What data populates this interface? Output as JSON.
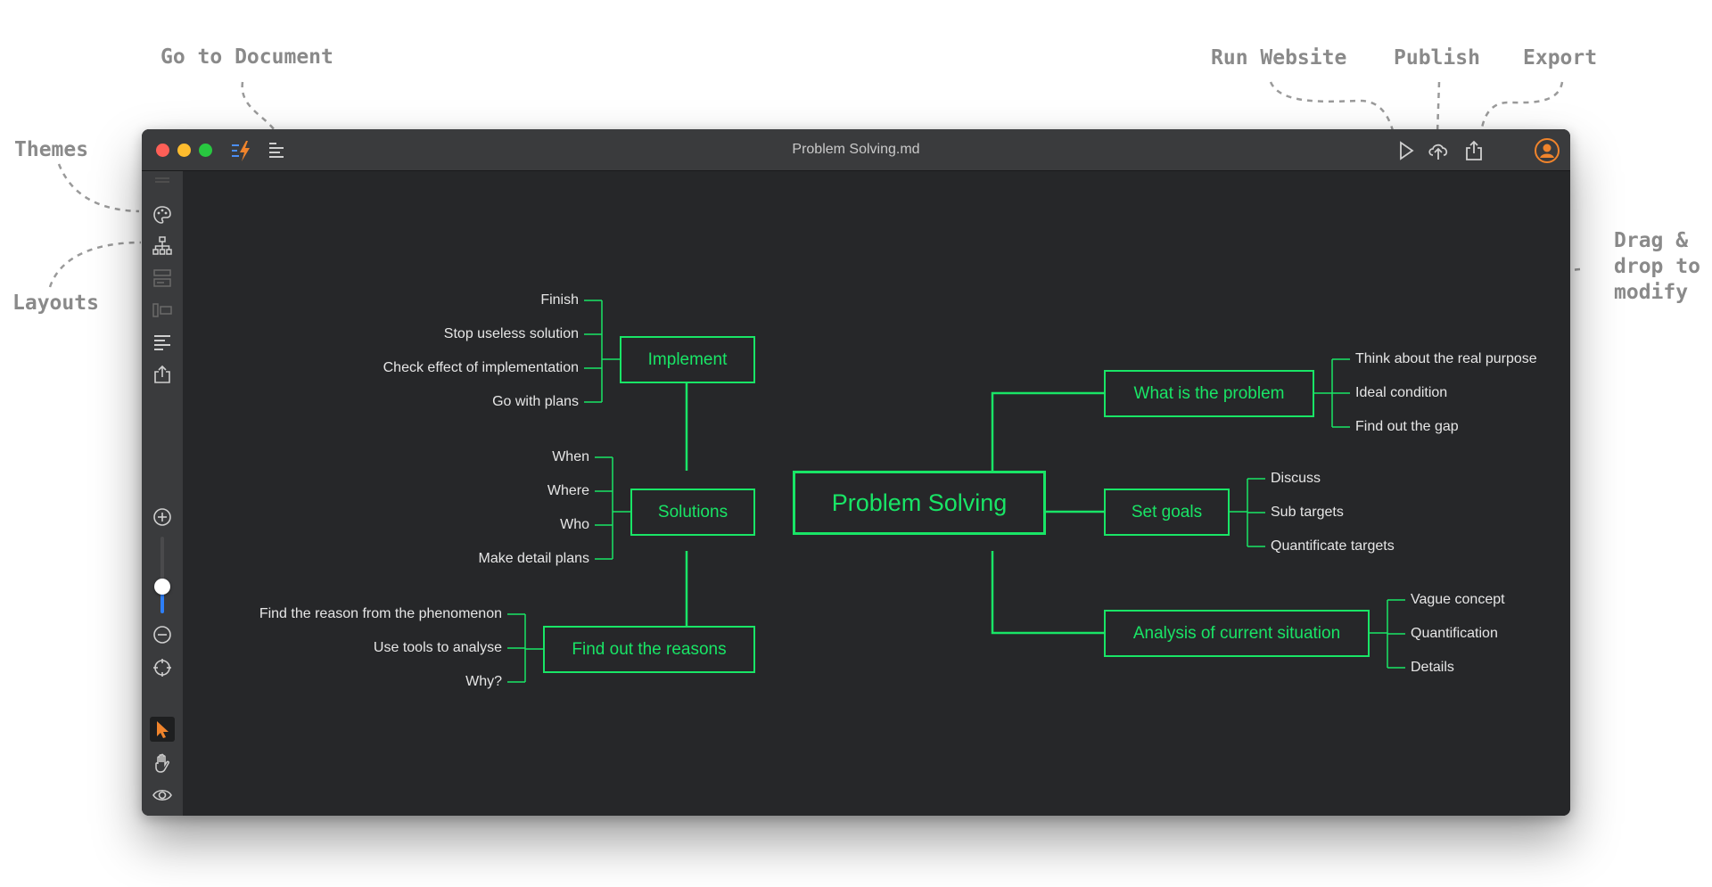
{
  "callouts": {
    "go_to_document": "Go to Document",
    "themes": "Themes",
    "layouts": "Layouts",
    "run_website": "Run Website",
    "publish": "Publish",
    "export": "Export",
    "drag_drop_line1": "Drag &",
    "drag_drop_line2": "drop to",
    "drag_drop_line3": "modify"
  },
  "window": {
    "title": "Problem Solving.md",
    "colors": {
      "background": "#262729",
      "chrome": "#3a3b3d",
      "accent": "#19e566",
      "leaf_text": "#e6e6e6",
      "user_accent": "#f0842c"
    },
    "toolbar_icons": [
      "lightning-logo-icon",
      "document-outline-icon",
      "play-icon",
      "cloud-upload-icon",
      "share-export-icon",
      "user-avatar-icon"
    ],
    "sidebar_icons": [
      "palette-icon",
      "hierarchy-layout-icon",
      "outline-panel-icon",
      "split-panel-icon",
      "text-align-icon",
      "share-icon",
      "zoom-in-icon",
      "zoom-out-icon",
      "recenter-icon",
      "pointer-tool-icon",
      "hand-tool-icon",
      "preview-eye-icon"
    ],
    "zoom_level": 0.35
  },
  "mindmap": {
    "root": "Problem Solving",
    "branches": {
      "implement": {
        "label": "Implement",
        "children": [
          "Finish",
          "Stop useless solution",
          "Check effect of implementation",
          "Go with plans"
        ]
      },
      "solutions": {
        "label": "Solutions",
        "children": [
          "When",
          "Where",
          "Who",
          "Make detail plans"
        ]
      },
      "reasons": {
        "label": "Find out the reasons",
        "children": [
          "Find the reason from the phenomenon",
          "Use tools to analyse",
          "Why?"
        ]
      },
      "problem": {
        "label": "What is the problem",
        "children": [
          "Think about the real purpose",
          "Ideal condition",
          "Find out the gap"
        ]
      },
      "goals": {
        "label": "Set goals",
        "children": [
          "Discuss",
          "Sub targets",
          "Quantificate targets"
        ]
      },
      "analysis": {
        "label": "Analysis of current situation",
        "children": [
          "Vague concept",
          "Quantification",
          "Details"
        ]
      }
    }
  }
}
